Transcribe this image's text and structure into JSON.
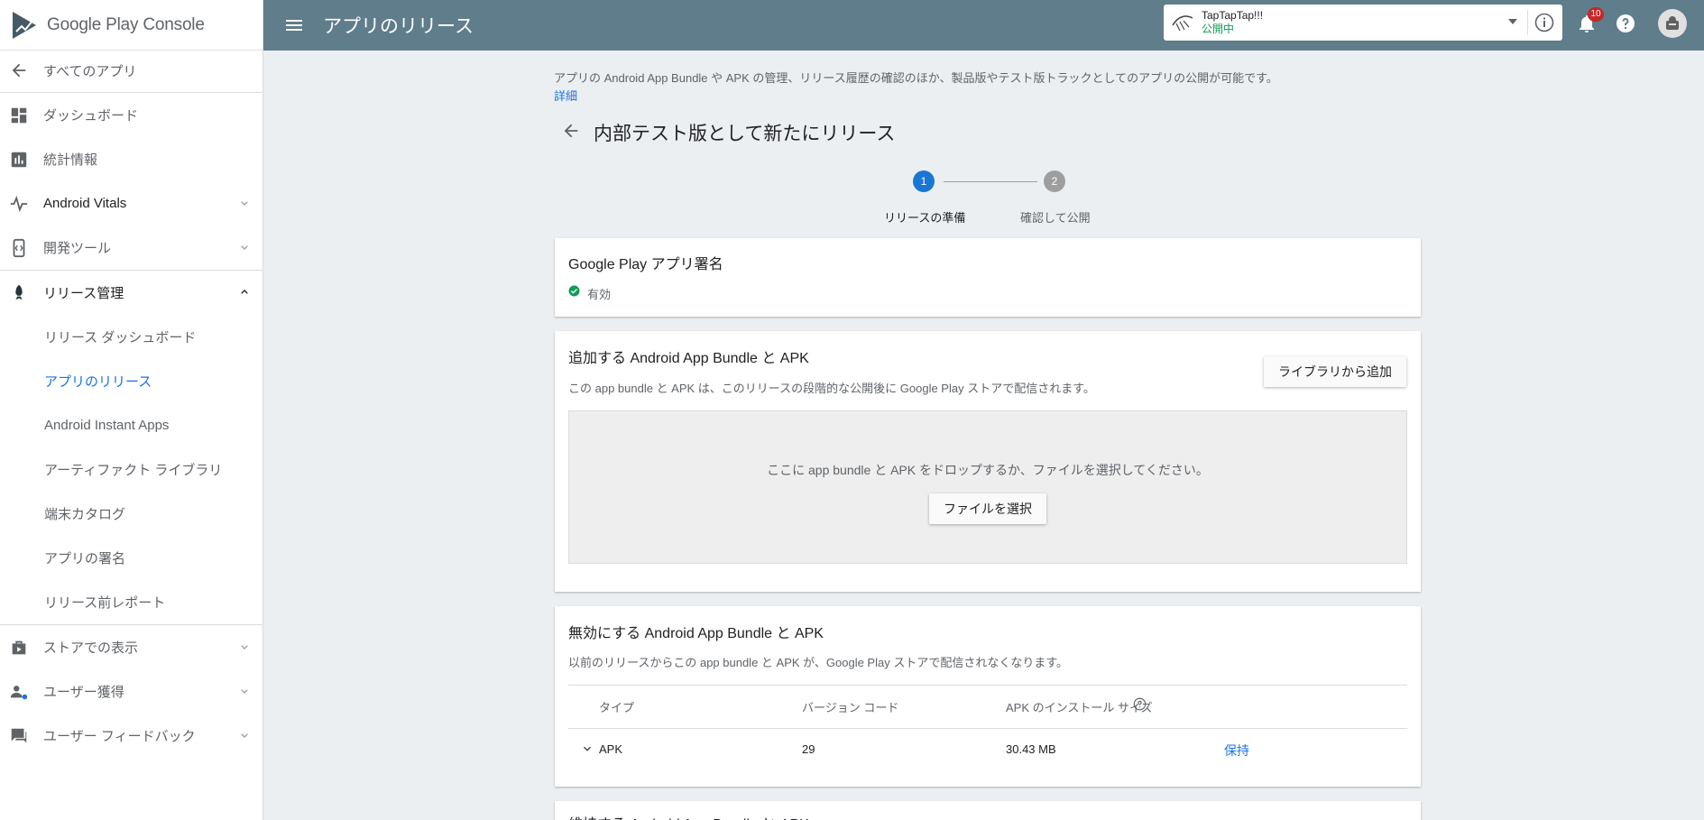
{
  "sidebar": {
    "logo_text": "Google Play Console",
    "back_label": "すべてのアプリ",
    "items": [
      {
        "label": "ダッシュボード"
      },
      {
        "label": "統計情報"
      },
      {
        "label": "Android Vitals"
      },
      {
        "label": "開発ツール"
      },
      {
        "label": "リリース管理"
      }
    ],
    "release_sub": [
      {
        "label": "リリース ダッシュボード"
      },
      {
        "label": "アプリのリリース"
      },
      {
        "label": "Android Instant Apps"
      },
      {
        "label": "アーティファクト ライブラリ"
      },
      {
        "label": "端末カタログ"
      },
      {
        "label": "アプリの署名"
      },
      {
        "label": "リリース前レポート"
      }
    ],
    "bottom_items": [
      {
        "label": "ストアでの表示"
      },
      {
        "label": "ユーザー獲得"
      },
      {
        "label": "ユーザー フィードバック"
      }
    ]
  },
  "header": {
    "title": "アプリのリリース",
    "app_name": "TapTapTap!!!",
    "app_status": "公開中",
    "notification_count": "10",
    "status_color": "#0f9d58"
  },
  "main": {
    "intro": "アプリの Android App Bundle や APK の管理、リリース履歴の確認のほか、製品版やテスト版トラックとしてのアプリの公開が可能です。",
    "intro_link": "詳細",
    "release_title": "内部テスト版として新たにリリース",
    "steps": [
      {
        "number": "1",
        "label": "リリースの準備"
      },
      {
        "number": "2",
        "label": "確認して公開"
      }
    ],
    "signing": {
      "title": "Google Play アプリ署名",
      "status": "有効"
    },
    "add_bundle": {
      "title": "追加する Android App Bundle と APK",
      "desc": "この app bundle と APK は、このリリースの段階的な公開後に Google Play ストアで配信されます。",
      "library_button": "ライブラリから追加",
      "drop_text": "ここに app bundle と APK をドロップするか、ファイルを選択してください。",
      "choose_button": "ファイルを選択"
    },
    "deactivate": {
      "title": "無効にする Android App Bundle と APK",
      "desc": "以前のリリースからこの app bundle と APK が、Google Play ストアで配信されなくなります。",
      "columns": [
        "タイプ",
        "バージョン コード",
        "APK のインストール サイズ"
      ],
      "row": {
        "type": "APK",
        "version": "29",
        "size": "30.43 MB",
        "action": "保持"
      }
    },
    "next_card_title": "維持する Android App Bundle と APK"
  },
  "colors": {
    "topbar": "#607d8b",
    "accent": "#1a73e8",
    "step_active": "#1976d2"
  }
}
